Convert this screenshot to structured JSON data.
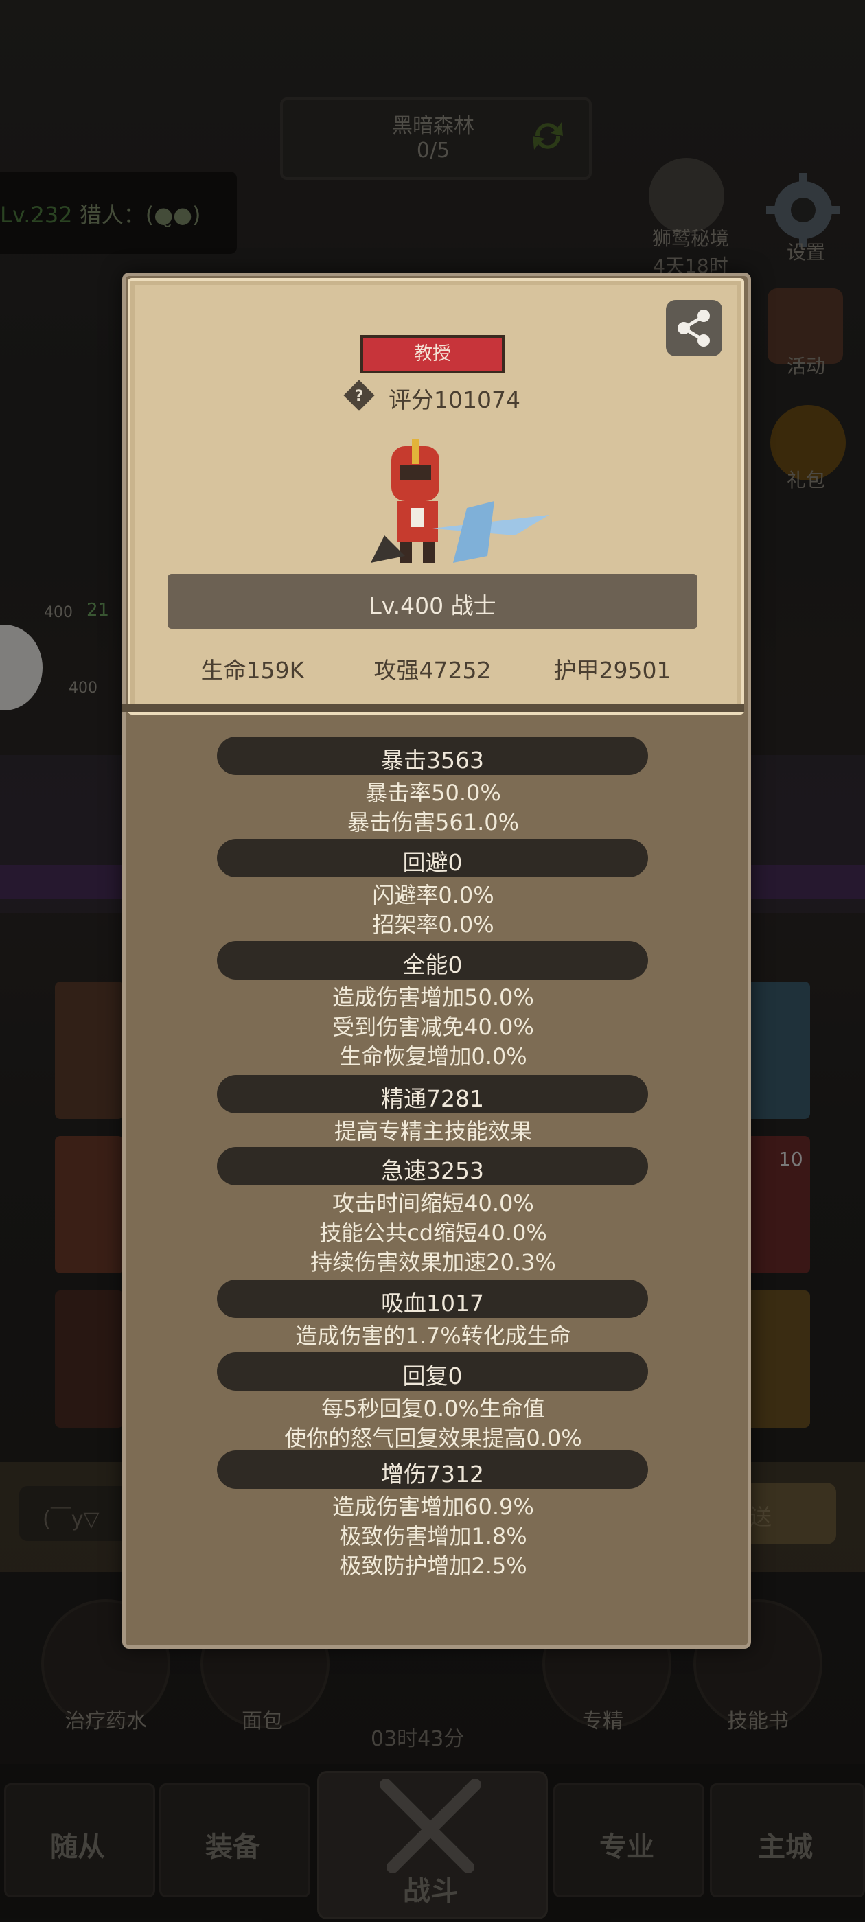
{
  "background": {
    "zone": {
      "name": "黑暗森林",
      "progress": "0/5"
    },
    "hunter": {
      "level": "Lv.232",
      "text": " 猎人：(●̮●)"
    },
    "side_menu": [
      {
        "label": "狮鹫秘境",
        "sub": "4天18时",
        "icon": "griffin-icon"
      },
      {
        "label": "设置",
        "icon": "gear-icon"
      },
      {
        "label": "活动",
        "icon": "activity-icon"
      },
      {
        "label": "礼包",
        "icon": "gift-pot-icon"
      }
    ],
    "side_numbers": [
      "400",
      "21",
      "400"
    ],
    "chat": {
      "placeholder": "(￣y▽",
      "send": "发送"
    },
    "items": [
      {
        "label": "治疗药水",
        "icon": "potion-icon"
      },
      {
        "label": "面包",
        "icon": "bread-icon"
      },
      {
        "label": "专精",
        "icon": "specialization-icon"
      },
      {
        "label": "技能书",
        "icon": "skill-book-icon"
      }
    ],
    "timer": "03时43分",
    "slot_badge": "10",
    "nav": [
      "随从",
      "装备",
      "战斗",
      "专业",
      "主城"
    ]
  },
  "dialog": {
    "title_badge": "教授",
    "score": "评分101074",
    "level": "Lv.400 战士",
    "stats": [
      "生命159K",
      "攻强47252",
      "护甲29501"
    ],
    "sections": [
      {
        "header": "暴击3563",
        "lines": [
          "暴击率50.0%",
          "暴击伤害561.0%"
        ]
      },
      {
        "header": "回避0",
        "lines": [
          "闪避率0.0%",
          "招架率0.0%"
        ]
      },
      {
        "header": "全能0",
        "lines": [
          "造成伤害增加50.0%",
          "受到伤害减免40.0%",
          "生命恢复增加0.0%"
        ]
      },
      {
        "header": "精通7281",
        "lines": [
          "提高专精主技能效果"
        ]
      },
      {
        "header": "急速3253",
        "lines": [
          "攻击时间缩短40.0%",
          "技能公共cd缩短40.0%",
          "持续伤害效果加速20.3%"
        ]
      },
      {
        "header": "吸血1017",
        "lines": [
          "造成伤害的1.7%转化成生命"
        ]
      },
      {
        "header": "回复0",
        "lines": [
          "每5秒回复0.0%生命值",
          "使你的怒气回复效果提高0.0%"
        ]
      },
      {
        "header": "增伤7312",
        "lines": [
          "造成伤害增加60.9%",
          "极致伤害增加1.8%",
          "极致防护增加2.5%"
        ]
      }
    ]
  },
  "colors": {
    "badge_red": "#c7343a",
    "parchment": "#d7c39d",
    "dialog_bg": "#7d6c54"
  }
}
